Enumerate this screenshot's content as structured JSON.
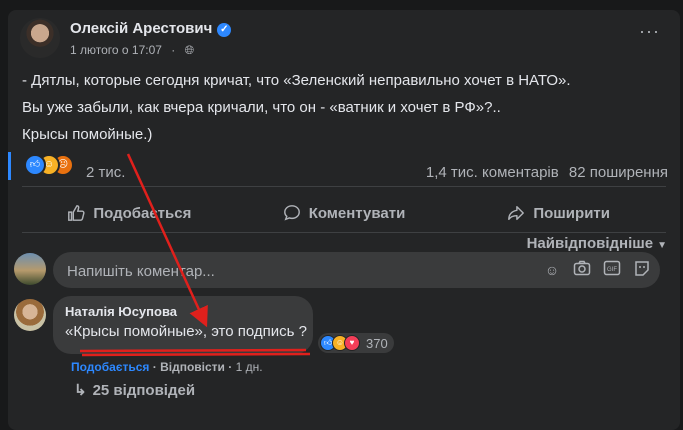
{
  "post": {
    "author": "Олексій Арестович",
    "timestamp": "1 лютого о 17:07",
    "lines": [
      "- Дятлы, которые сегодня кричат, что «Зеленский неправильно хочет в НАТО».",
      "Вы уже забыли, как вчера кричали, что он - «ватник и хочет в РФ»?..",
      "Крысы помойные.)"
    ],
    "reactions_count": "2 тис.",
    "comments_count": "1,4 тис. коментарів",
    "shares_count": "82 поширення"
  },
  "actions": {
    "like": "Подобається",
    "comment": "Коментувати",
    "share": "Поширити"
  },
  "sort_label": "Найвідповідніше",
  "comment_input": {
    "placeholder": "Напишіть коментар..."
  },
  "comment": {
    "author": "Наталія Юсупова",
    "text": "«Крысы помойные», это подпись ?",
    "reactions_count": "370",
    "like": "Подобається",
    "reply": "Відповісти",
    "time": "1 дн.",
    "replies": "25 відповідей"
  },
  "colors": {
    "background": "#18191a",
    "card": "#242526",
    "accent": "#2d88ff",
    "annotation": "#e0201c"
  }
}
